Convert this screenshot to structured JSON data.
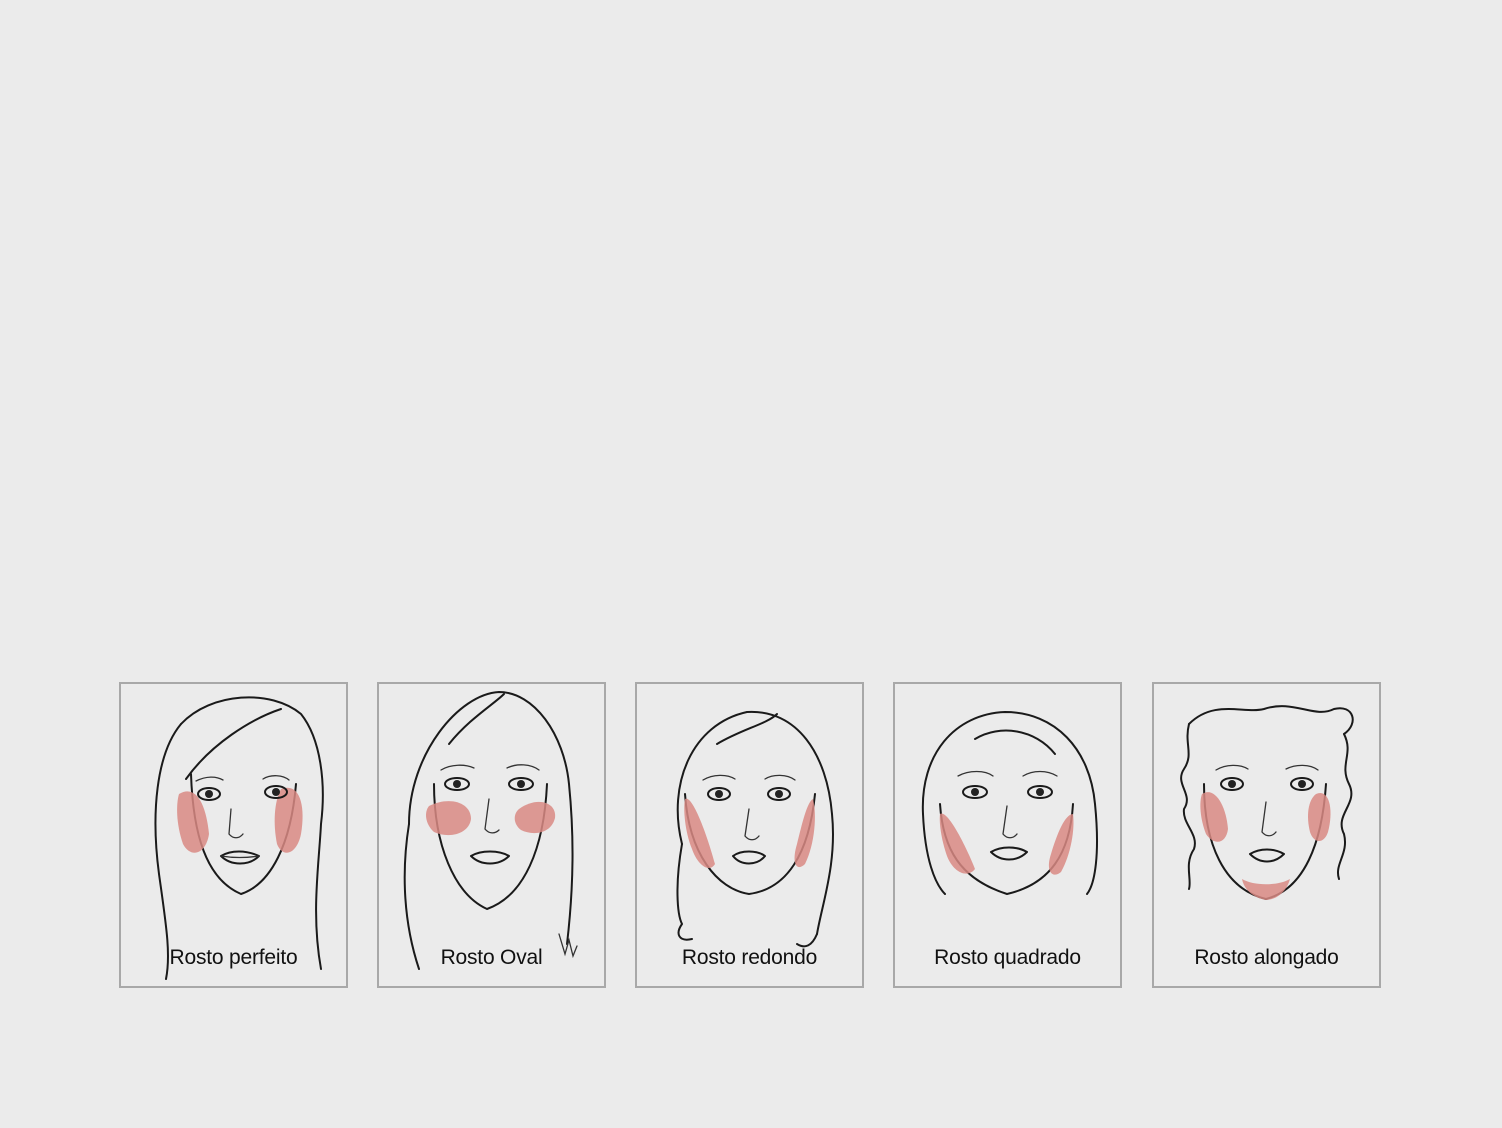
{
  "panels": [
    {
      "caption": "Rosto perfeito",
      "blush_color": "#d98a84"
    },
    {
      "caption": "Rosto Oval",
      "blush_color": "#d98a84"
    },
    {
      "caption": "Rosto redondo",
      "blush_color": "#d98a84"
    },
    {
      "caption": "Rosto quadrado",
      "blush_color": "#d98a84"
    },
    {
      "caption": "Rosto alongado",
      "blush_color": "#d98a84"
    }
  ]
}
